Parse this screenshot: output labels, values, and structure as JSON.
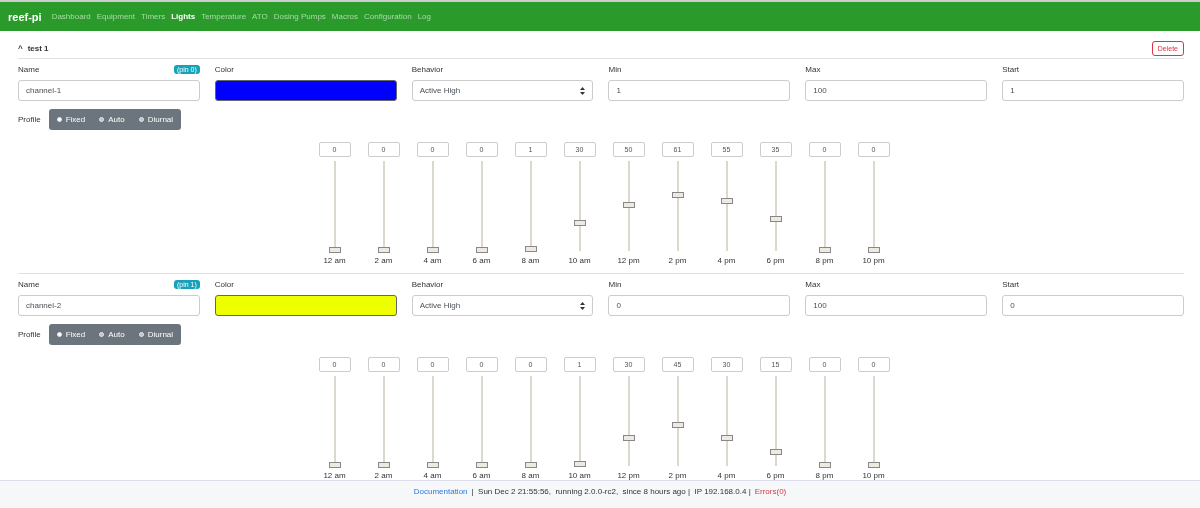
{
  "navbar": {
    "brand": "reef-pi",
    "items": [
      {
        "label": "Dashboard",
        "selected": false
      },
      {
        "label": "Equipment",
        "selected": false
      },
      {
        "label": "Timers",
        "selected": false
      },
      {
        "label": "Lights",
        "selected": true
      },
      {
        "label": "Temperature",
        "selected": false
      },
      {
        "label": "ATO",
        "selected": false
      },
      {
        "label": "Dosing Pumps",
        "selected": false
      },
      {
        "label": "Macros",
        "selected": false
      },
      {
        "label": "Configuration",
        "selected": false
      },
      {
        "label": "Log",
        "selected": false
      }
    ]
  },
  "light": {
    "title": "test 1",
    "toggle": "^",
    "expanded": true,
    "delete_button": "Delete",
    "channels": [
      {
        "name_label": "Name",
        "pin": "(pin 0)",
        "name": "channel-1",
        "color_label": "Color",
        "color": "#0000ff",
        "behavior_label": "Behavior",
        "behavior": "Active High",
        "min_label": "Min",
        "min": "1",
        "max_label": "Max",
        "max": "100",
        "start_label": "Start",
        "start": "1",
        "profile_label": "Profile",
        "profiles": [
          {
            "label": "Fixed",
            "selected": true
          },
          {
            "label": "Auto",
            "selected": false
          },
          {
            "label": "Diurnal",
            "selected": false
          }
        ],
        "points": [
          {
            "value": "0",
            "time": "12 am",
            "level": 0
          },
          {
            "value": "0",
            "time": "2 am",
            "level": 0
          },
          {
            "value": "0",
            "time": "4 am",
            "level": 0
          },
          {
            "value": "0",
            "time": "6 am",
            "level": 0
          },
          {
            "value": "1",
            "time": "8 am",
            "level": 0.01
          },
          {
            "value": "30",
            "time": "10 am",
            "level": 0.3
          },
          {
            "value": "50",
            "time": "12 pm",
            "level": 0.5
          },
          {
            "value": "61",
            "time": "2 pm",
            "level": 0.61
          },
          {
            "value": "55",
            "time": "4 pm",
            "level": 0.55
          },
          {
            "value": "35",
            "time": "6 pm",
            "level": 0.35
          },
          {
            "value": "0",
            "time": "8 pm",
            "level": 0
          },
          {
            "value": "0",
            "time": "10 pm",
            "level": 0
          }
        ]
      },
      {
        "name_label": "Name",
        "pin": "(pin 1)",
        "name": "channel-2",
        "color_label": "Color",
        "color": "#eeff00",
        "behavior_label": "Behavior",
        "behavior": "Active High",
        "min_label": "Min",
        "min": "0",
        "max_label": "Max",
        "max": "100",
        "start_label": "Start",
        "start": "0",
        "profile_label": "Profile",
        "profiles": [
          {
            "label": "Fixed",
            "selected": true
          },
          {
            "label": "Auto",
            "selected": false
          },
          {
            "label": "Diurnal",
            "selected": false
          }
        ],
        "points": [
          {
            "value": "0",
            "time": "12 am",
            "level": 0
          },
          {
            "value": "0",
            "time": "2 am",
            "level": 0
          },
          {
            "value": "0",
            "time": "4 am",
            "level": 0
          },
          {
            "value": "0",
            "time": "6 am",
            "level": 0
          },
          {
            "value": "0",
            "time": "8 am",
            "level": 0
          },
          {
            "value": "1",
            "time": "10 am",
            "level": 0.01
          },
          {
            "value": "30",
            "time": "12 pm",
            "level": 0.3
          },
          {
            "value": "45",
            "time": "2 pm",
            "level": 0.45
          },
          {
            "value": "30",
            "time": "4 pm",
            "level": 0.3
          },
          {
            "value": "15",
            "time": "6 pm",
            "level": 0.15
          },
          {
            "value": "0",
            "time": "8 pm",
            "level": 0
          },
          {
            "value": "0",
            "time": "10 pm",
            "level": 0
          }
        ]
      }
    ]
  },
  "footer": {
    "link": "Documentation",
    "status": "|  Sun Dec 2 21:55:56,  running 2.0.0-rc2,  since 8 hours ago |  IP 192.168.0.4 |",
    "errors": "Errors(0)"
  }
}
